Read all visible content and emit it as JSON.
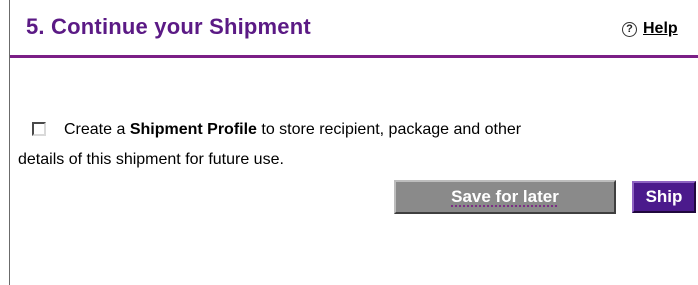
{
  "section": {
    "title": "5. Continue your Shipment",
    "help_icon": "question-circle-icon",
    "help_label": "Help"
  },
  "profile_option": {
    "checked": false,
    "text_prefix": "Create a ",
    "text_bold": "Shipment Profile",
    "text_suffix": " to store recipient, package and other",
    "text_line2": "details of this shipment for future use."
  },
  "actions": {
    "save_for_later_label": "Save for later",
    "ship_label": "Ship"
  },
  "colors": {
    "accent_purple": "#5b1a85",
    "ship_button": "#4b1a8c",
    "save_button": "#8a8a8a"
  }
}
